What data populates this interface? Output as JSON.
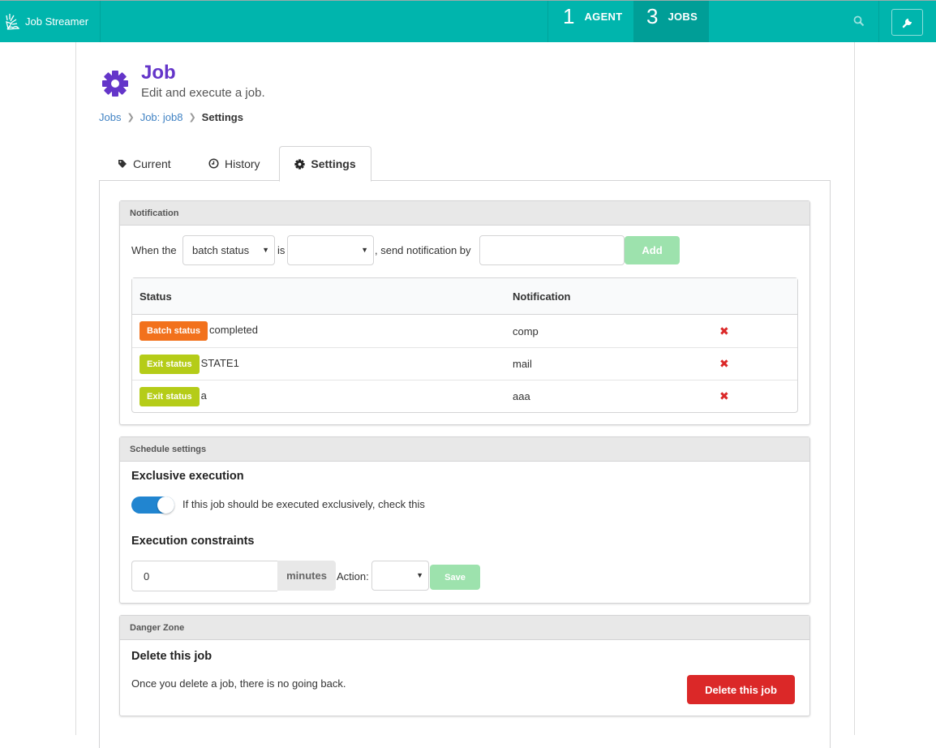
{
  "app": {
    "brand": "Job Streamer",
    "nav": [
      {
        "count": "1",
        "label": "AGENT"
      },
      {
        "count": "3",
        "label": "JOBS"
      }
    ],
    "icons": {
      "search": "search-icon",
      "settings": "wrench-icon",
      "logo": "sunrise-logo-icon"
    }
  },
  "header": {
    "title": "Job",
    "subtitle": "Edit and execute a job.",
    "icon": "gear-icon",
    "title_color": "#6435c9"
  },
  "breadcrumb": [
    {
      "label": "Jobs",
      "link": true
    },
    {
      "label": "Job: job8",
      "link": true
    },
    {
      "label": "Settings",
      "link": false
    }
  ],
  "tabs": [
    {
      "label": "Current",
      "icon": "tag-icon",
      "active": false
    },
    {
      "label": "History",
      "icon": "clock-icon",
      "active": false
    },
    {
      "label": "Settings",
      "icon": "gear-icon",
      "active": true
    }
  ],
  "notification": {
    "section_title": "Notification",
    "prefix": "When the",
    "type_select": {
      "value": "batch status"
    },
    "is_label": "is",
    "status_select": {
      "value": ""
    },
    "send_label": ", send notification by",
    "notify_input": {
      "value": "",
      "placeholder": ""
    },
    "add_label": "Add",
    "table": {
      "columns": [
        "Status",
        "Notification",
        ""
      ],
      "rows": [
        {
          "badge": "Batch status",
          "badge_color": "#f2711c",
          "status": "completed",
          "notification": "comp"
        },
        {
          "badge": "Exit status",
          "badge_color": "#b5cc18",
          "status": "STATE1",
          "notification": "mail"
        },
        {
          "badge": "Exit status",
          "badge_color": "#b5cc18",
          "status": "a",
          "notification": "aaa"
        }
      ],
      "delete_glyph": "✖"
    }
  },
  "schedule": {
    "section_title": "Schedule settings",
    "exclusive_heading": "Exclusive execution",
    "exclusive_toggle": {
      "checked": true,
      "label": "If this job should be executed exclusively, check this"
    },
    "constraints_heading": "Execution constraints",
    "minutes_input": {
      "value": "0"
    },
    "minutes_addon": "minutes",
    "action_label": "Action:",
    "action_select": {
      "value": ""
    },
    "save_label": "Save"
  },
  "danger": {
    "section_title": "Danger Zone",
    "heading": "Delete this job",
    "text": "Once you delete a job, there is no going back.",
    "button_label": "Delete this job",
    "button_color": "#db2828"
  }
}
